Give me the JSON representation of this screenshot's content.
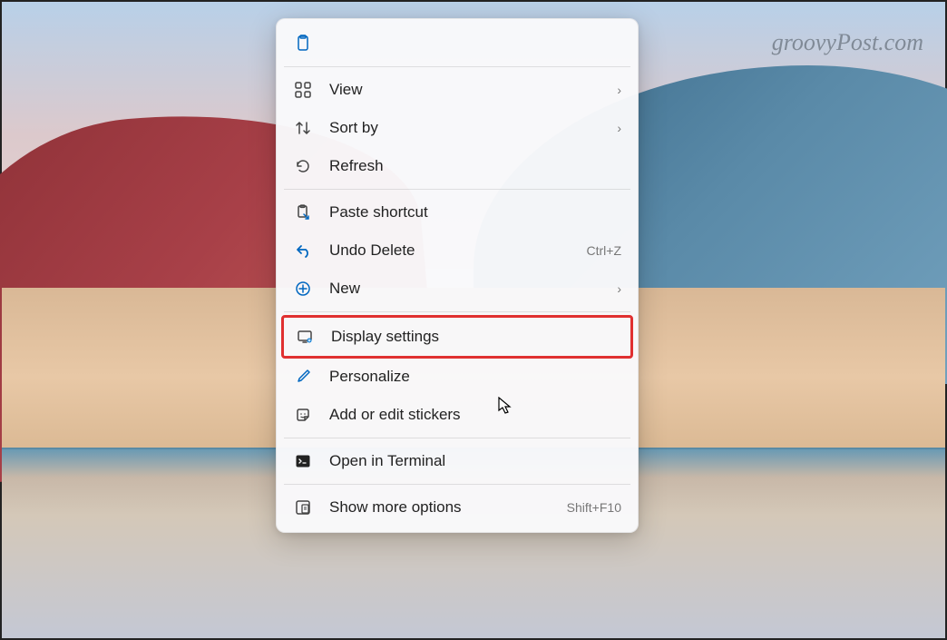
{
  "watermark": "groovyPost.com",
  "menu": {
    "items": [
      {
        "label": "View",
        "has_submenu": true
      },
      {
        "label": "Sort by",
        "has_submenu": true
      },
      {
        "label": "Refresh"
      },
      {
        "label": "Paste shortcut"
      },
      {
        "label": "Undo Delete",
        "shortcut": "Ctrl+Z"
      },
      {
        "label": "New",
        "has_submenu": true
      },
      {
        "label": "Display settings",
        "highlighted": true
      },
      {
        "label": "Personalize"
      },
      {
        "label": "Add or edit stickers"
      },
      {
        "label": "Open in Terminal"
      },
      {
        "label": "Show more options",
        "shortcut": "Shift+F10"
      }
    ]
  }
}
